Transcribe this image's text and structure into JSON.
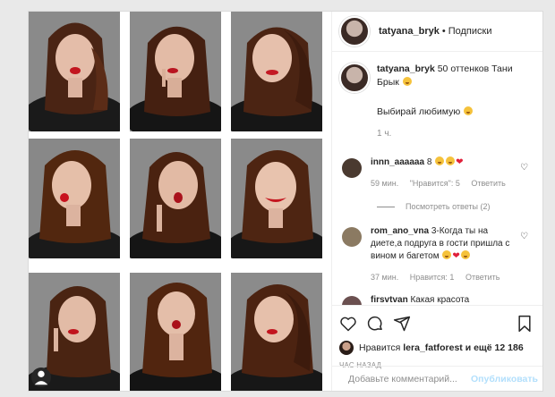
{
  "post": {
    "author": "tatyana_bryk",
    "follow_label": "Подписки",
    "separator": "•",
    "caption_text": "50 оттенков Тани Брык",
    "caption_line2": "Выбирай любимую",
    "caption_time": "1 ч."
  },
  "comments": [
    {
      "username": "innn_aaaaaa",
      "text": "8",
      "time": "59 мин.",
      "likes": "\"Нравится\": 5",
      "reply": "Ответить",
      "view_replies": "Посмотреть ответы (2)",
      "avatar_color": "#4a3a30"
    },
    {
      "username": "rom_ano_vna",
      "text": "3-Когда ты на диете,а подруга в гости пришла с вином и багетом",
      "time": "37 мин.",
      "likes": "Нравится: 1",
      "reply": "Ответить",
      "avatar_color": "#8b7a62"
    },
    {
      "username": "firsvtvan",
      "text": "Какая красота",
      "avatar_color": "#6b5050"
    }
  ],
  "actions": {
    "liked_by_prefix": "Нравится",
    "liked_by_user": "lera_fatforest",
    "liked_by_suffix": "и ещё 12 186",
    "time_ago": "час назад",
    "comment_placeholder": "Добавьте комментарий...",
    "publish_label": "Опубликовать"
  },
  "colors": {
    "link": "#b2dffc",
    "heart": "#e0203a",
    "muted": "#8e8e8e"
  },
  "icons": [
    "heart-icon",
    "comment-icon",
    "share-icon",
    "bookmark-icon",
    "smile-icon",
    "user-tag-icon"
  ]
}
